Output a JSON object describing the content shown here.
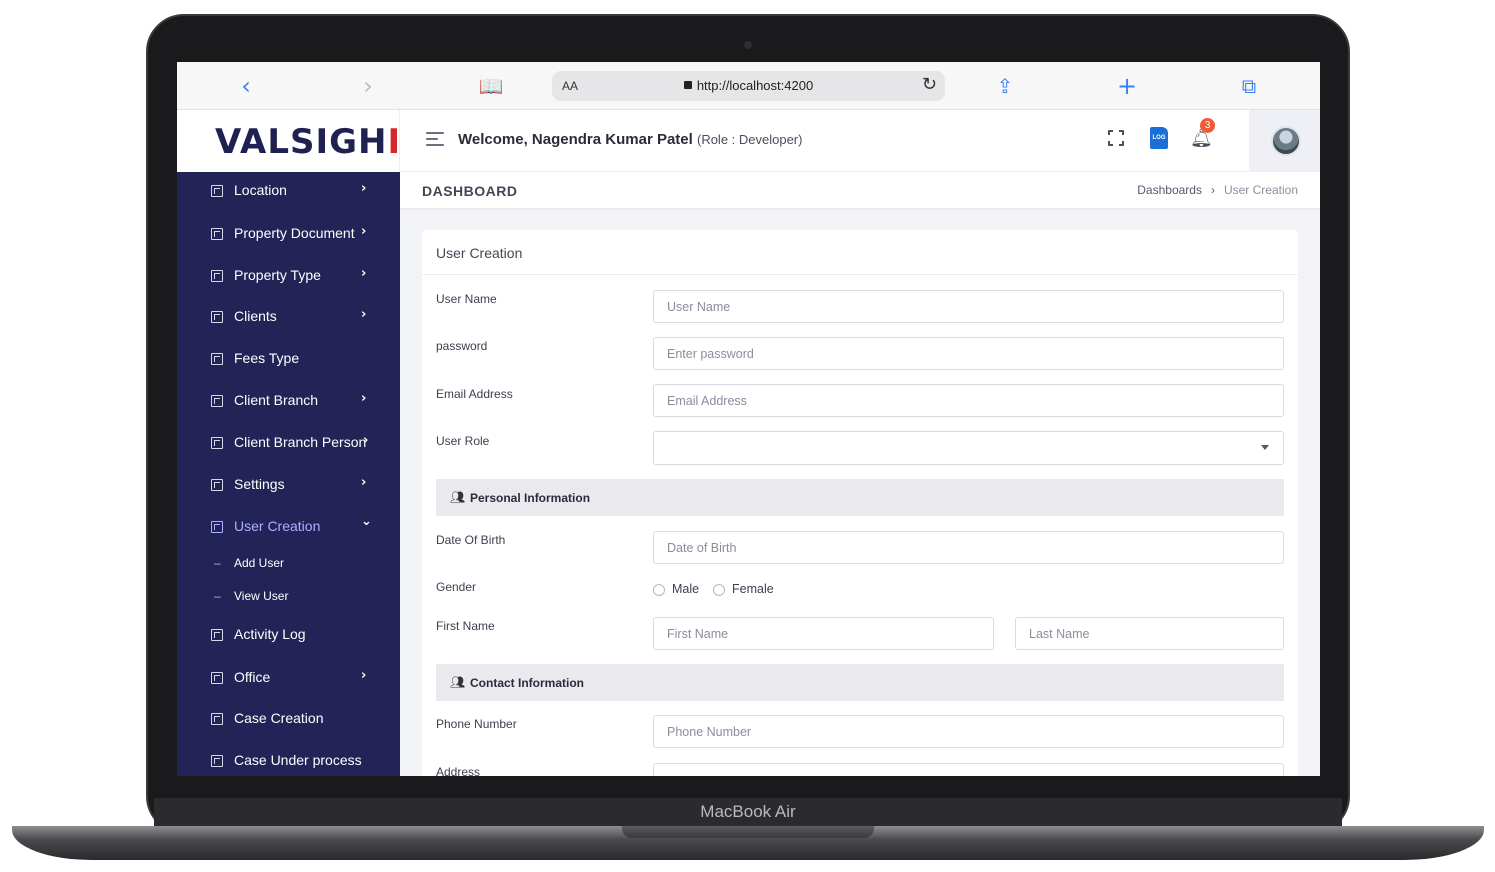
{
  "device": {
    "label": "MacBook Air"
  },
  "browser": {
    "aa_label": "AA",
    "url": "http://localhost:4200",
    "icons": [
      "back-icon",
      "forward-icon",
      "bookmarks-icon",
      "reload-icon",
      "share-icon",
      "new-tab-icon",
      "tabs-icon"
    ]
  },
  "app": {
    "logo_main": "VALSIGH",
    "logo_accent": "IT"
  },
  "header": {
    "welcome": "Welcome, Nagendra Kumar Patel",
    "role": "(Role : Developer)",
    "log_icon_label": "LOG",
    "notification_count": "3"
  },
  "sidebar": {
    "items": [
      {
        "label": "Location",
        "chevron": "›"
      },
      {
        "label": "Property Document",
        "chevron": "›"
      },
      {
        "label": "Property Type",
        "chevron": "›"
      },
      {
        "label": "Clients",
        "chevron": "›"
      },
      {
        "label": "Fees Type",
        "chevron": ""
      },
      {
        "label": "Client Branch",
        "chevron": "›"
      },
      {
        "label": "Client Branch Person",
        "chevron": "›"
      },
      {
        "label": "Settings",
        "chevron": "›"
      },
      {
        "label": "User Creation",
        "chevron": "⌄"
      },
      {
        "label": "Activity Log",
        "chevron": ""
      },
      {
        "label": "Office",
        "chevron": "›"
      },
      {
        "label": "Case Creation",
        "chevron": ""
      },
      {
        "label": "Case Under process",
        "chevron": ""
      }
    ],
    "sub_items": [
      {
        "label": "Add User"
      },
      {
        "label": "View User"
      }
    ]
  },
  "page": {
    "title": "DASHBOARD",
    "breadcrumb": {
      "root": "Dashboards",
      "separator": "›",
      "current": "User Creation"
    }
  },
  "form": {
    "title": "User Creation",
    "fields": {
      "username": {
        "label": "User Name",
        "placeholder": "User Name"
      },
      "password": {
        "label": "password",
        "placeholder": "Enter password"
      },
      "email": {
        "label": "Email Address",
        "placeholder": "Email Address"
      },
      "role": {
        "label": "User Role",
        "value": ""
      },
      "dob": {
        "label": "Date Of Birth",
        "placeholder": "Date of Birth"
      },
      "gender": {
        "label": "Gender",
        "options": [
          "Male",
          "Female"
        ]
      },
      "name": {
        "label": "First Name",
        "first_placeholder": "First Name",
        "last_placeholder": "Last Name"
      },
      "phone": {
        "label": "Phone Number",
        "placeholder": "Phone Number"
      },
      "address": {
        "label": "Address"
      }
    },
    "sections": {
      "personal": "Personal Information",
      "contact": "Contact Information"
    }
  }
}
